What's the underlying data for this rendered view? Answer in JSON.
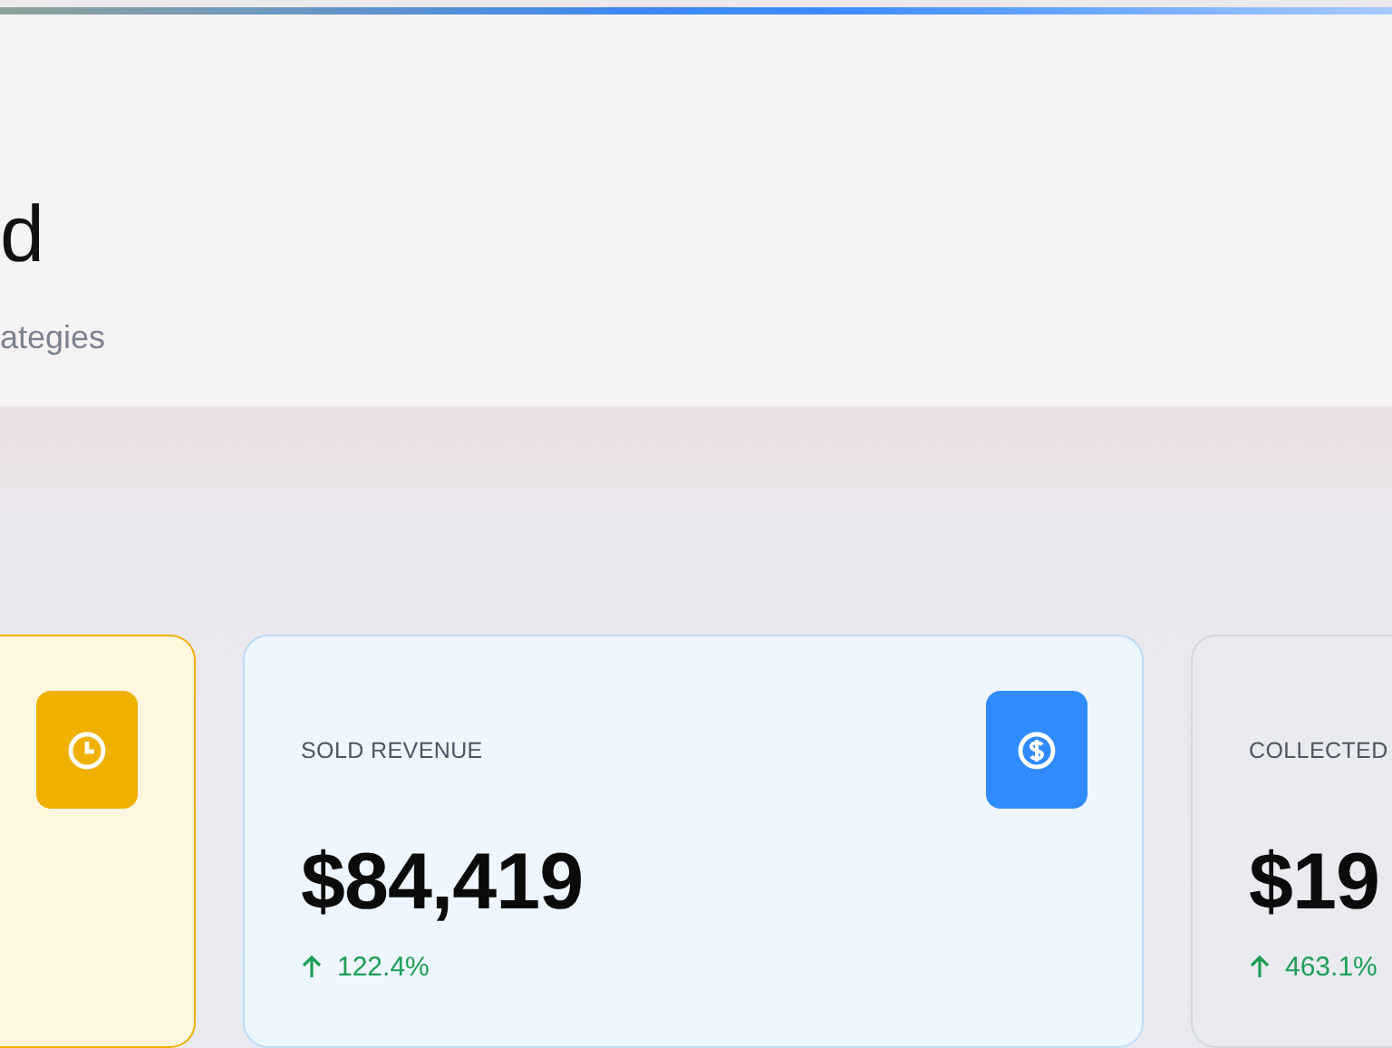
{
  "header": {
    "title": "d",
    "subtitle": "ategies"
  },
  "cards": [
    {
      "kind": "amber",
      "icon": {
        "kind": "clock",
        "color": "#f0b000"
      }
    },
    {
      "kind": "blue",
      "label": "SOLD REVENUE",
      "value": "$84,419",
      "change": {
        "kind": "up",
        "text": "122.4%"
      },
      "icon": {
        "kind": "dollar",
        "color": "#2f8bff"
      }
    },
    {
      "kind": "gray",
      "label": "COLLECTED",
      "value": "$19",
      "change": {
        "kind": "up",
        "text": "463.1%"
      }
    }
  ]
}
